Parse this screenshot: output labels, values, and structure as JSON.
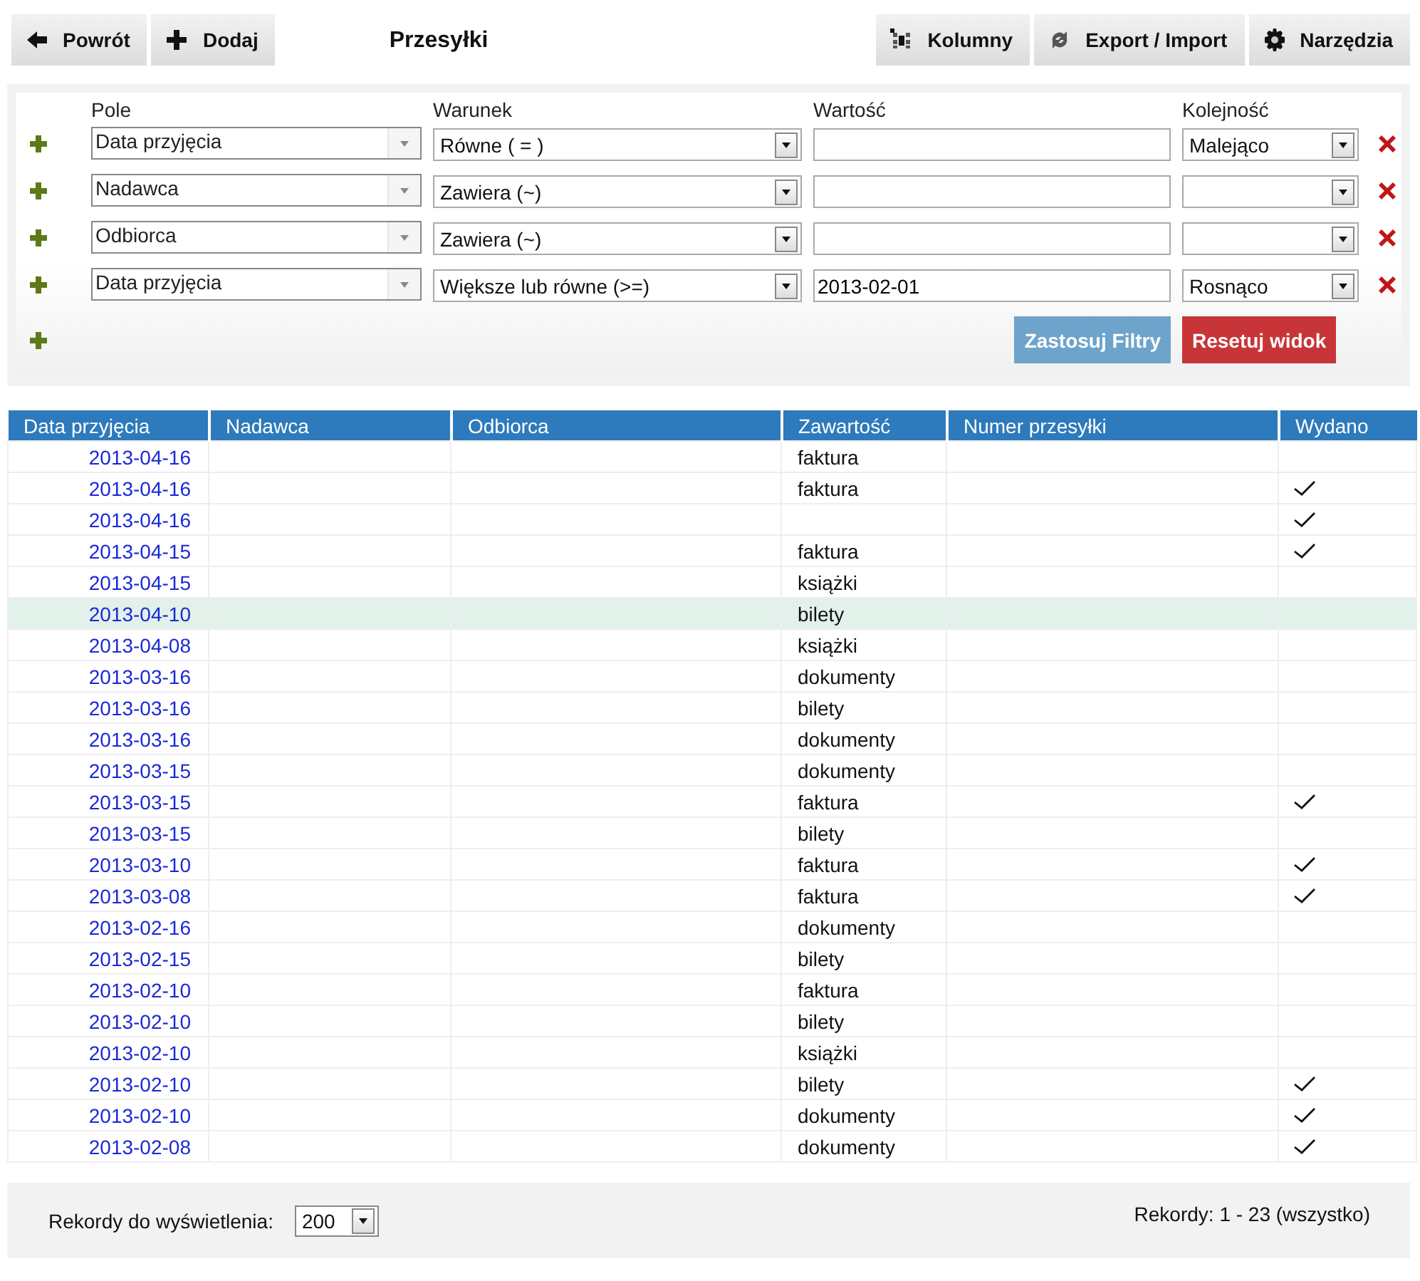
{
  "toolbar": {
    "left": [
      {
        "label": "Powrót"
      },
      {
        "label": "Dodaj"
      }
    ],
    "title": "Przesyłki",
    "right": [
      {
        "label": "Kolumny"
      },
      {
        "label": "Export / Import"
      },
      {
        "label": "Narzędzia"
      }
    ]
  },
  "filters": {
    "headers": [
      "Pole",
      "Warunek",
      "Wartość",
      "Kolejność"
    ],
    "rows": [
      {
        "field": "Data przyjęcia",
        "condition": "Równe ( = )",
        "value": "",
        "order": "Malejąco"
      },
      {
        "field": "Nadawca",
        "condition": "Zawiera (~)",
        "value": "",
        "order": ""
      },
      {
        "field": "Odbiorca",
        "condition": "Zawiera (~)",
        "value": "",
        "order": ""
      },
      {
        "field": "Data przyjęcia",
        "condition": "Większe lub równe (>=)",
        "value": "2013-02-01",
        "order": "Rosnąco"
      }
    ],
    "apply_button": "Zastosuj Filtry",
    "reset_button": "Resetuj widok"
  },
  "table": {
    "columns": [
      "Data przyjęcia",
      "Nadawca",
      "Odbiorca",
      "Zawartość",
      "Numer przesyłki",
      "Wydano"
    ],
    "rows": [
      {
        "date": "2013-04-16",
        "content": "faktura",
        "issued": false,
        "selected": false
      },
      {
        "date": "2013-04-16",
        "content": "faktura",
        "issued": true,
        "selected": false
      },
      {
        "date": "2013-04-16",
        "content": "",
        "issued": true,
        "selected": false
      },
      {
        "date": "2013-04-15",
        "content": "faktura",
        "issued": true,
        "selected": false
      },
      {
        "date": "2013-04-15",
        "content": "książki",
        "issued": false,
        "selected": false
      },
      {
        "date": "2013-04-10",
        "content": "bilety",
        "issued": false,
        "selected": true
      },
      {
        "date": "2013-04-08",
        "content": "książki",
        "issued": false,
        "selected": false
      },
      {
        "date": "2013-03-16",
        "content": "dokumenty",
        "issued": false,
        "selected": false
      },
      {
        "date": "2013-03-16",
        "content": "bilety",
        "issued": false,
        "selected": false
      },
      {
        "date": "2013-03-16",
        "content": "dokumenty",
        "issued": false,
        "selected": false
      },
      {
        "date": "2013-03-15",
        "content": "dokumenty",
        "issued": false,
        "selected": false
      },
      {
        "date": "2013-03-15",
        "content": "faktura",
        "issued": true,
        "selected": false
      },
      {
        "date": "2013-03-15",
        "content": "bilety",
        "issued": false,
        "selected": false
      },
      {
        "date": "2013-03-10",
        "content": "faktura",
        "issued": true,
        "selected": false
      },
      {
        "date": "2013-03-08",
        "content": "faktura",
        "issued": true,
        "selected": false
      },
      {
        "date": "2013-02-16",
        "content": "dokumenty",
        "issued": false,
        "selected": false
      },
      {
        "date": "2013-02-15",
        "content": "bilety",
        "issued": false,
        "selected": false
      },
      {
        "date": "2013-02-10",
        "content": "faktura",
        "issued": false,
        "selected": false
      },
      {
        "date": "2013-02-10",
        "content": "bilety",
        "issued": false,
        "selected": false
      },
      {
        "date": "2013-02-10",
        "content": "książki",
        "issued": false,
        "selected": false
      },
      {
        "date": "2013-02-10",
        "content": "bilety",
        "issued": true,
        "selected": false
      },
      {
        "date": "2013-02-10",
        "content": "dokumenty",
        "issued": true,
        "selected": false
      },
      {
        "date": "2013-02-08",
        "content": "dokumenty",
        "issued": true,
        "selected": false
      }
    ]
  },
  "footer": {
    "page_size_label": "Rekordy do wyświetlenia:",
    "page_size": "200",
    "records": "Rekordy: 1 - 23 (wszystko)"
  }
}
